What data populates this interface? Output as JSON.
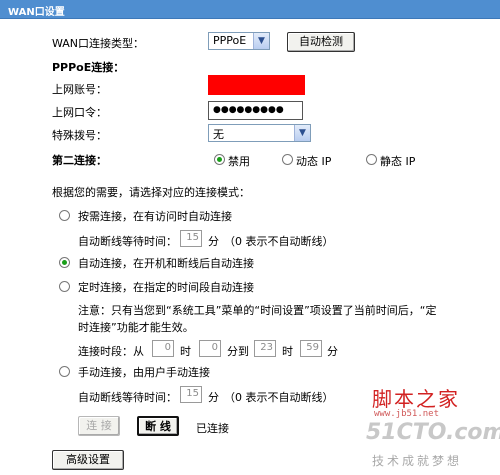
{
  "window": {
    "title": "WAN口设置"
  },
  "wan_type": {
    "label": "WAN口连接类型：",
    "value": "PPPoE",
    "detect_button": "自动检测"
  },
  "pppoe": {
    "section_label": "PPPoE连接：",
    "account_label": "上网账号：",
    "password_label": "上网口令：",
    "password_value": "●●●●●●●●●",
    "special_dial_label": "特殊拨号：",
    "special_dial_value": "无"
  },
  "second_connection": {
    "label": "第二连接：",
    "options": [
      "禁用",
      "动态 IP",
      "静态 IP"
    ],
    "selected": "禁用"
  },
  "mode": {
    "intro": "根据您的需要，请选择对应的连接模式：",
    "on_demand": {
      "label": "按需连接，在有访问时自动连接",
      "idle_prefix": "自动断线等待时间：",
      "idle_value": "15",
      "idle_unit": "分",
      "idle_note": "（0 表示不自动断线）"
    },
    "auto": {
      "label": "自动连接，在开机和断线后自动连接",
      "selected": true
    },
    "timed": {
      "label": "定时连接，在指定的时间段自动连接",
      "note_line1": "注意：只有当您到“系统工具”菜单的“时间设置”项设置了当前时间后，“定",
      "note_line2": "时连接”功能才能生效。",
      "period_prefix": "连接时段：从",
      "from_hour": "0",
      "hour_unit": "时",
      "from_min": "0",
      "to_text": "分到",
      "to_hour": "23",
      "to_min": "59",
      "min_unit": "分"
    },
    "manual": {
      "label": "手动连接，由用户手动连接",
      "idle_prefix": "自动断线等待时间：",
      "idle_value": "15",
      "idle_unit": "分",
      "idle_note": "（0 表示不自动断线）"
    }
  },
  "actions": {
    "connect": "连 接",
    "disconnect": "断 线",
    "status": "已连接",
    "advanced": "高级设置"
  },
  "watermark": {
    "line1": "脚本之家",
    "line2": "www.jb51.net",
    "line3": "51CTO.com",
    "line4": "技术成就梦想"
  },
  "colors": {
    "titlebar": "#4f8ed0",
    "radio_selected": "#1a9f1a",
    "redaction": "#ff0000"
  }
}
